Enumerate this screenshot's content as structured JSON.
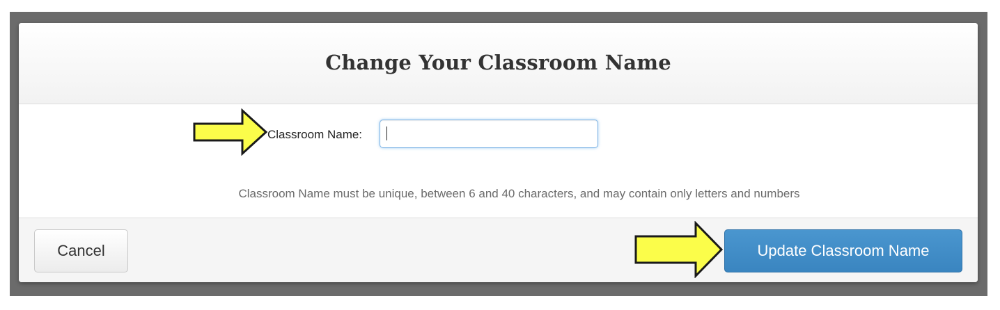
{
  "dialog": {
    "title": "Change Your Classroom Name",
    "field_label": "Classroom Name:",
    "input_value": "",
    "help_text": "Classroom Name must be unique, between 6 and 40 characters, and may contain only letters and numbers"
  },
  "footer": {
    "cancel_label": "Cancel",
    "submit_label": "Update Classroom Name"
  },
  "colors": {
    "primary_button": "#3a85c0",
    "arrow_fill": "#fbfd4a",
    "arrow_stroke": "#1a1a1a"
  },
  "icons": [
    "arrow-right-icon"
  ]
}
